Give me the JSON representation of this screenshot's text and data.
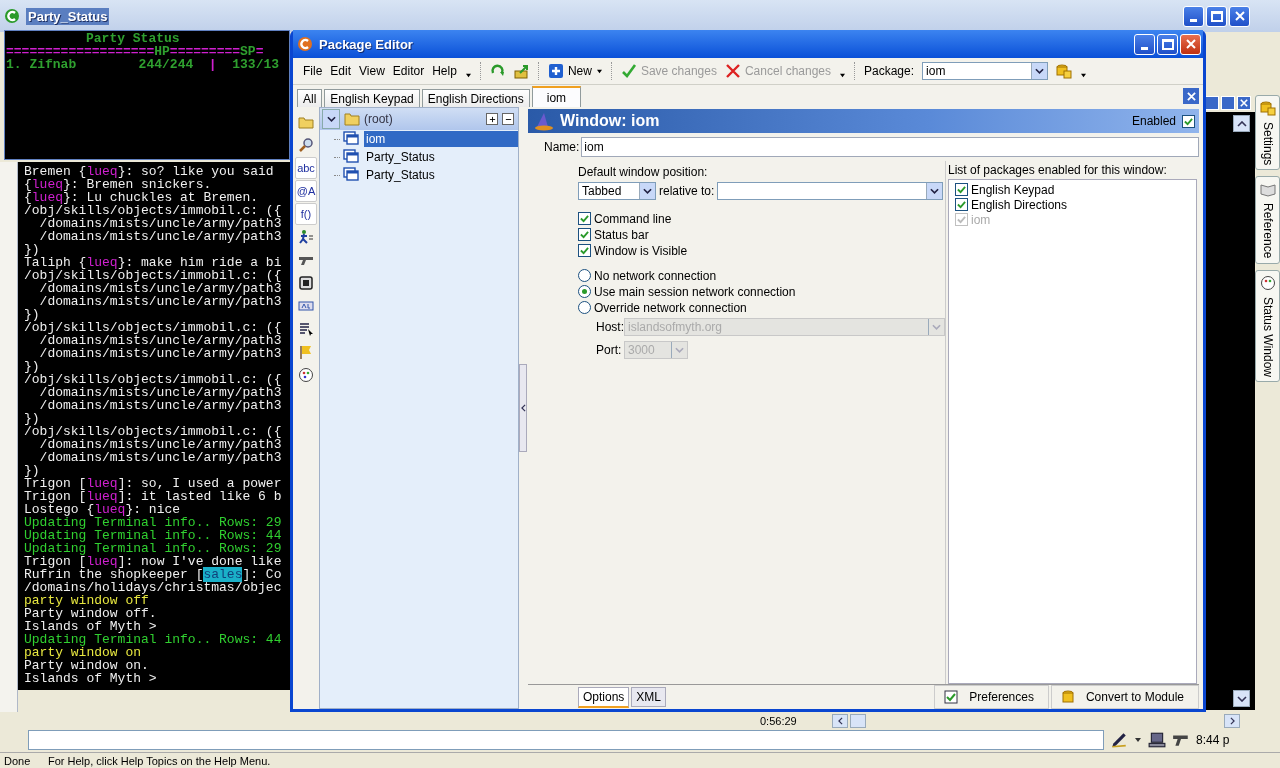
{
  "main_window": {
    "title": "Party_Status"
  },
  "party_status": [
    {
      "kind": "heading",
      "segments": [
        {
          "text": "Party Status",
          "color": "#2fa02f"
        }
      ]
    },
    {
      "kind": "row",
      "segments": [
        {
          "text": "===================",
          "color": "#d020d0"
        },
        {
          "text": "HP",
          "color": "#2fa02f"
        },
        {
          "text": "=========",
          "color": "#d020d0"
        },
        {
          "text": "SP",
          "color": "#2fa02f"
        },
        {
          "text": "=",
          "color": "#d020d0"
        }
      ]
    },
    {
      "kind": "row",
      "segments": [
        {
          "text": "1. Zifnab        244/244  ",
          "color": "#2fa02f"
        },
        {
          "text": "|",
          "color": "#d020d0"
        },
        {
          "text": "  133/13",
          "color": "#2fa02f"
        }
      ]
    }
  ],
  "terminal": [
    {
      "segments": [
        {
          "text": "Bremen {",
          "color": "#f0f0f0"
        },
        {
          "text": "lueq",
          "color": "#d020d0"
        },
        {
          "text": "}: so? like you said",
          "color": "#f0f0f0"
        }
      ]
    },
    {
      "segments": [
        {
          "text": "{",
          "color": "#f0f0f0"
        },
        {
          "text": "lueq",
          "color": "#d020d0"
        },
        {
          "text": "}: Bremen snickers.",
          "color": "#f0f0f0"
        }
      ]
    },
    {
      "segments": [
        {
          "text": "{",
          "color": "#f0f0f0"
        },
        {
          "text": "lueq",
          "color": "#d020d0"
        },
        {
          "text": "}: Lu chuckles at Bremen.",
          "color": "#f0f0f0"
        }
      ]
    },
    {
      "segments": [
        {
          "text": "/obj/skills/objects/immobil.c: ({",
          "color": "#f0f0f0"
        }
      ]
    },
    {
      "segments": [
        {
          "text": "  /domains/mists/uncle/army/path3",
          "color": "#f0f0f0"
        }
      ]
    },
    {
      "segments": [
        {
          "text": "  /domains/mists/uncle/army/path3",
          "color": "#f0f0f0"
        }
      ]
    },
    {
      "segments": [
        {
          "text": "})",
          "color": "#f0f0f0"
        }
      ]
    },
    {
      "segments": [
        {
          "text": "Taliph {",
          "color": "#f0f0f0"
        },
        {
          "text": "lueq",
          "color": "#d020d0"
        },
        {
          "text": "}: make him ride a bi",
          "color": "#f0f0f0"
        }
      ]
    },
    {
      "segments": [
        {
          "text": "/obj/skills/objects/immobil.c: ({",
          "color": "#f0f0f0"
        }
      ]
    },
    {
      "segments": [
        {
          "text": "  /domains/mists/uncle/army/path3",
          "color": "#f0f0f0"
        }
      ]
    },
    {
      "segments": [
        {
          "text": "  /domains/mists/uncle/army/path3",
          "color": "#f0f0f0"
        }
      ]
    },
    {
      "segments": [
        {
          "text": "})",
          "color": "#f0f0f0"
        }
      ]
    },
    {
      "segments": [
        {
          "text": "/obj/skills/objects/immobil.c: ({",
          "color": "#f0f0f0"
        }
      ]
    },
    {
      "segments": [
        {
          "text": "  /domains/mists/uncle/army/path3",
          "color": "#f0f0f0"
        }
      ]
    },
    {
      "segments": [
        {
          "text": "  /domains/mists/uncle/army/path3",
          "color": "#f0f0f0"
        }
      ]
    },
    {
      "segments": [
        {
          "text": "})",
          "color": "#f0f0f0"
        }
      ]
    },
    {
      "segments": [
        {
          "text": "/obj/skills/objects/immobil.c: ({",
          "color": "#f0f0f0"
        }
      ]
    },
    {
      "segments": [
        {
          "text": "  /domains/mists/uncle/army/path3",
          "color": "#f0f0f0"
        }
      ]
    },
    {
      "segments": [
        {
          "text": "  /domains/mists/uncle/army/path3",
          "color": "#f0f0f0"
        }
      ]
    },
    {
      "segments": [
        {
          "text": "})",
          "color": "#f0f0f0"
        }
      ]
    },
    {
      "segments": [
        {
          "text": "/obj/skills/objects/immobil.c: ({",
          "color": "#f0f0f0"
        }
      ]
    },
    {
      "segments": [
        {
          "text": "  /domains/mists/uncle/army/path3",
          "color": "#f0f0f0"
        }
      ]
    },
    {
      "segments": [
        {
          "text": "  /domains/mists/uncle/army/path3",
          "color": "#f0f0f0"
        }
      ]
    },
    {
      "segments": [
        {
          "text": "})",
          "color": "#f0f0f0"
        }
      ]
    },
    {
      "segments": [
        {
          "text": "Trigon [",
          "color": "#f0f0f0"
        },
        {
          "text": "lueq",
          "color": "#d020d0"
        },
        {
          "text": "]: so, I used a power",
          "color": "#f0f0f0"
        }
      ]
    },
    {
      "segments": [
        {
          "text": "Trigon [",
          "color": "#f0f0f0"
        },
        {
          "text": "lueq",
          "color": "#d020d0"
        },
        {
          "text": "]: it lasted like 6 b",
          "color": "#f0f0f0"
        }
      ]
    },
    {
      "segments": [
        {
          "text": "Lostego {",
          "color": "#f0f0f0"
        },
        {
          "text": "lueq",
          "color": "#d020d0"
        },
        {
          "text": "}: nice",
          "color": "#f0f0f0"
        }
      ]
    },
    {
      "segments": [
        {
          "text": "Updating Terminal info.. Rows: 29",
          "color": "#30d030"
        }
      ]
    },
    {
      "segments": [
        {
          "text": "Updating Terminal info.. Rows: 44",
          "color": "#30d030"
        }
      ]
    },
    {
      "segments": [
        {
          "text": "Updating Terminal info.. Rows: 29",
          "color": "#30d030"
        }
      ]
    },
    {
      "segments": [
        {
          "text": "Trigon [",
          "color": "#f0f0f0"
        },
        {
          "text": "lueq",
          "color": "#d020d0"
        },
        {
          "text": "]: now I've done like",
          "color": "#f0f0f0"
        }
      ]
    },
    {
      "segments": [
        {
          "text": "Rufrin the shopkeeper [",
          "color": "#f0f0f0"
        },
        {
          "text": "sales",
          "color": "#1ab0c8",
          "kind": "highlight"
        },
        {
          "text": "]: Co",
          "color": "#f0f0f0"
        }
      ]
    },
    {
      "segments": [
        {
          "text": "/domains/holidays/christmas/objec",
          "color": "#f0f0f0"
        }
      ]
    },
    {
      "segments": [
        {
          "text": "party window off",
          "color": "#e8e840"
        }
      ]
    },
    {
      "segments": [
        {
          "text": "Party window off.",
          "color": "#f0f0f0"
        }
      ]
    },
    {
      "segments": [
        {
          "text": "Islands of Myth >",
          "color": "#f0f0f0"
        }
      ]
    },
    {
      "segments": [
        {
          "text": "Updating Terminal info.. Rows: 44",
          "color": "#30d030"
        }
      ]
    },
    {
      "segments": [
        {
          "text": "party window on",
          "color": "#e8e840"
        }
      ]
    },
    {
      "segments": [
        {
          "text": "Party window on.",
          "color": "#f0f0f0"
        }
      ]
    },
    {
      "segments": [
        {
          "text": "Islands of Myth >",
          "color": "#f0f0f0"
        }
      ]
    }
  ],
  "dock_tabs": [
    {
      "label": "Settings"
    },
    {
      "label": "Reference"
    },
    {
      "label": "Status Window"
    }
  ],
  "status_row": {
    "time": "0:56:29",
    "clock": "8:44 p",
    "status": "Done",
    "help": "For Help, click Help Topics on the Help Menu."
  },
  "editor": {
    "title": "Package Editor",
    "menu": [
      "File",
      "Edit",
      "View",
      "Editor",
      "Help"
    ],
    "toolbar": {
      "new": "New",
      "save": {
        "label": "Save changes",
        "disabled": true
      },
      "cancel": {
        "label": "Cancel changes",
        "disabled": true
      },
      "package_label": "Package:",
      "package_value": "iom"
    },
    "tabs": [
      {
        "label": "All",
        "selected": false
      },
      {
        "label": "English Keypad",
        "selected": false
      },
      {
        "label": "English Directions",
        "selected": false
      },
      {
        "label": "iom",
        "selected": true
      }
    ],
    "tools": [
      {
        "kind": "icon"
      },
      {
        "kind": "icon"
      },
      {
        "kind": "text",
        "label": "abc"
      },
      {
        "kind": "text",
        "label": "@A"
      },
      {
        "kind": "text",
        "label": "f()"
      },
      {
        "kind": "icon"
      },
      {
        "kind": "icon"
      },
      {
        "kind": "icon"
      },
      {
        "kind": "icon"
      },
      {
        "kind": "icon"
      },
      {
        "kind": "icon"
      },
      {
        "kind": "icon"
      }
    ],
    "tree": {
      "label": "(root)",
      "expanded": true,
      "children": [
        {
          "label": "iom",
          "selected": true
        },
        {
          "label": "Party_Status",
          "selected": false
        },
        {
          "label": "Party_Status",
          "selected": false
        }
      ]
    },
    "header": {
      "title": "Window: iom",
      "enabled_label": "Enabled",
      "enabled": true
    },
    "name": {
      "label": "Name:",
      "value": "iom"
    },
    "position": {
      "label": "Default window position:",
      "value": "Tabbed",
      "relative_label": "relative to:"
    },
    "options": [
      {
        "label": "Command line",
        "checked": true
      },
      {
        "label": "Status bar",
        "checked": true
      },
      {
        "label": "Window is Visible",
        "checked": true
      }
    ],
    "network": [
      {
        "label": "No network connection",
        "selected": false
      },
      {
        "label": "Use main session network connection",
        "selected": true
      },
      {
        "label": "Override network connection",
        "selected": false
      }
    ],
    "host": {
      "label": "Host:",
      "value": "islandsofmyth.org",
      "disabled": true
    },
    "port": {
      "label": "Port:",
      "value": "3000",
      "disabled": true
    },
    "packages": {
      "title": "List of packages enabled for this window:",
      "items": [
        {
          "label": "English Keypad",
          "checked": true,
          "disabled": false
        },
        {
          "label": "English Directions",
          "checked": true,
          "disabled": false
        },
        {
          "label": "iom",
          "checked": true,
          "disabled": true
        }
      ]
    },
    "bottom_tabs": [
      {
        "label": "Options",
        "selected": true
      },
      {
        "label": "XML",
        "selected": false
      }
    ],
    "buttons": [
      "Preferences",
      "Convert to Module"
    ]
  }
}
